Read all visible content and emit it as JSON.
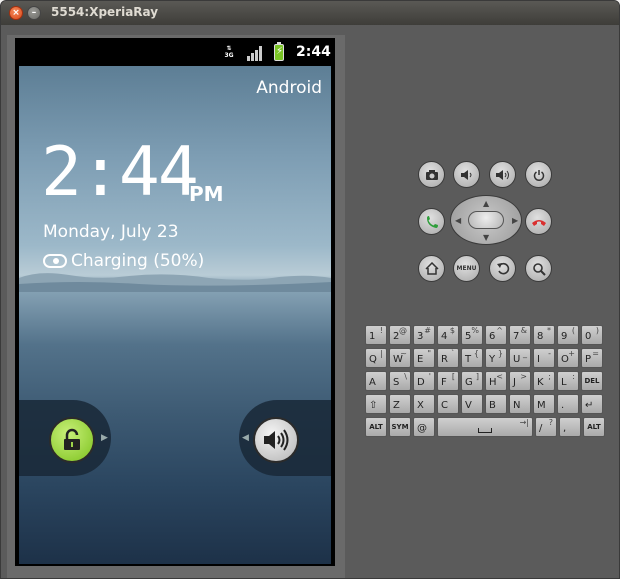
{
  "window": {
    "title": "5554:XperiaRay"
  },
  "statusbar": {
    "network": "3G",
    "time": "2:44"
  },
  "lockscreen": {
    "carrier": "Android",
    "clock": "2:44",
    "ampm": "PM",
    "date": "Monday, July 23",
    "charging": "Charging (50%)"
  },
  "keyboard": {
    "rows": [
      [
        {
          "m": "1",
          "s": "!"
        },
        {
          "m": "2",
          "s": "@"
        },
        {
          "m": "3",
          "s": "#"
        },
        {
          "m": "4",
          "s": "$"
        },
        {
          "m": "5",
          "s": "%"
        },
        {
          "m": "6",
          "s": "^"
        },
        {
          "m": "7",
          "s": "&"
        },
        {
          "m": "8",
          "s": "*"
        },
        {
          "m": "9",
          "s": "("
        },
        {
          "m": "0",
          "s": ")"
        }
      ],
      [
        {
          "m": "Q",
          "s": "|"
        },
        {
          "m": "W",
          "s": "~"
        },
        {
          "m": "E",
          "s": "\""
        },
        {
          "m": "R",
          "s": "`"
        },
        {
          "m": "T",
          "s": "{"
        },
        {
          "m": "Y",
          "s": "}"
        },
        {
          "m": "U",
          "s": "_"
        },
        {
          "m": "I",
          "s": "-"
        },
        {
          "m": "O",
          "s": "+"
        },
        {
          "m": "P",
          "s": "="
        }
      ],
      [
        {
          "m": "A",
          "s": ""
        },
        {
          "m": "S",
          "s": "\\"
        },
        {
          "m": "D",
          "s": "'"
        },
        {
          "m": "F",
          "s": "["
        },
        {
          "m": "G",
          "s": "]"
        },
        {
          "m": "H",
          "s": "<"
        },
        {
          "m": "J",
          "s": ">"
        },
        {
          "m": "K",
          "s": ";"
        },
        {
          "m": "L",
          "s": ":"
        },
        {
          "m": "DEL",
          "s": ""
        }
      ],
      [
        {
          "m": "⇧",
          "s": ""
        },
        {
          "m": "Z",
          "s": ""
        },
        {
          "m": "X",
          "s": ""
        },
        {
          "m": "C",
          "s": ""
        },
        {
          "m": "V",
          "s": ""
        },
        {
          "m": "B",
          "s": ""
        },
        {
          "m": "N",
          "s": ""
        },
        {
          "m": "M",
          "s": ""
        },
        {
          "m": ".",
          "s": ""
        },
        {
          "m": "↵",
          "s": ""
        }
      ],
      [
        {
          "m": "ALT",
          "s": ""
        },
        {
          "m": "SYM",
          "s": ""
        },
        {
          "m": "@",
          "s": ""
        },
        {
          "m": "",
          "s": "→|"
        },
        {
          "m": "/",
          "s": "?"
        },
        {
          "m": ",",
          "s": ""
        },
        {
          "m": "ALT",
          "s": ""
        }
      ]
    ]
  },
  "icons": {
    "camera": "camera-icon",
    "vol_down": "volume-down-icon",
    "vol_up": "volume-up-icon",
    "power": "power-icon",
    "call": "call-icon",
    "end_call": "end-call-icon",
    "home": "home-icon",
    "menu": "MENU",
    "back": "back-icon",
    "search": "search-icon"
  },
  "colors": {
    "unlock": "#7dc21e",
    "call": "#2e9e3a",
    "end_call": "#d93030"
  }
}
